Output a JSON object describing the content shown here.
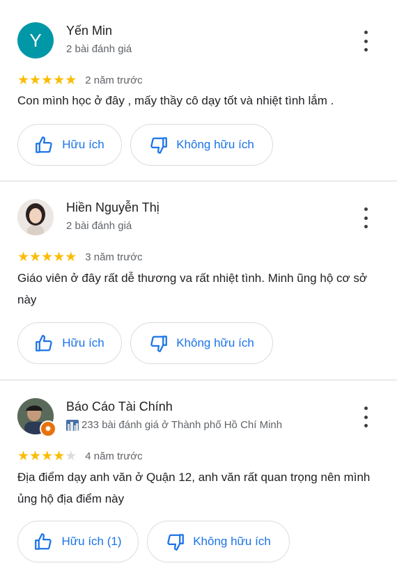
{
  "colors": {
    "accent": "#1a73e8",
    "star": "#fbbc04",
    "avatar_teal": "#0097a7",
    "badge": "#e8710a"
  },
  "reviews": [
    {
      "avatar_letter": "Y",
      "name": "Yến Min",
      "meta": "2 bài đánh giá",
      "rating": 5,
      "date": "2 năm trước",
      "text": "Con mình học ở đây , mấy thầy cô dạy tốt và nhiệt tình lắm .",
      "helpful_label": "Hữu ích",
      "not_helpful_label": "Không hữu ích"
    },
    {
      "avatar_letter": "",
      "name": "Hiền Nguyễn Thị",
      "meta": "2 bài đánh giá",
      "rating": 5,
      "date": "3 năm trước",
      "text": "Giáo viên ở đây rất dễ thương va rất nhiệt tình. Minh ũng hộ cơ sở này",
      "helpful_label": "Hữu ích",
      "not_helpful_label": "Không hữu ích"
    },
    {
      "avatar_letter": "",
      "name": "Báo Cáo Tài Chính",
      "meta": "233 bài đánh giá ở Thành phố Hồ Chí Minh",
      "rating": 4,
      "date": "4 năm trước",
      "text": "Địa điểm dạy anh văn ở Quận 12, anh văn rất quan trọng nên mình ủng hộ địa điểm này",
      "helpful_label": "Hữu ích (1)",
      "not_helpful_label": "Không hữu ích"
    }
  ]
}
